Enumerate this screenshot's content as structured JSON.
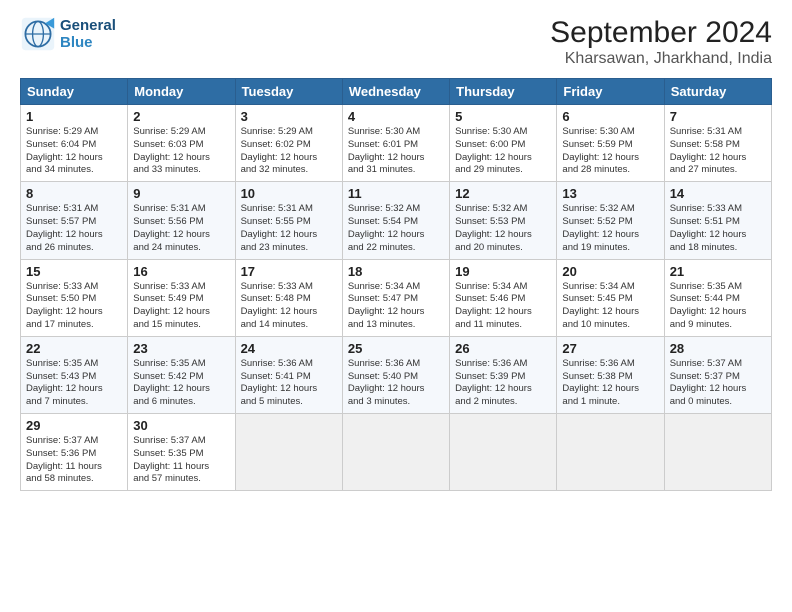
{
  "header": {
    "logo_line1": "General",
    "logo_line2": "Blue",
    "title": "September 2024",
    "subtitle": "Kharsawan, Jharkhand, India"
  },
  "days_of_week": [
    "Sunday",
    "Monday",
    "Tuesday",
    "Wednesday",
    "Thursday",
    "Friday",
    "Saturday"
  ],
  "weeks": [
    [
      {
        "day": "1",
        "detail": "Sunrise: 5:29 AM\nSunset: 6:04 PM\nDaylight: 12 hours\nand 34 minutes."
      },
      {
        "day": "2",
        "detail": "Sunrise: 5:29 AM\nSunset: 6:03 PM\nDaylight: 12 hours\nand 33 minutes."
      },
      {
        "day": "3",
        "detail": "Sunrise: 5:29 AM\nSunset: 6:02 PM\nDaylight: 12 hours\nand 32 minutes."
      },
      {
        "day": "4",
        "detail": "Sunrise: 5:30 AM\nSunset: 6:01 PM\nDaylight: 12 hours\nand 31 minutes."
      },
      {
        "day": "5",
        "detail": "Sunrise: 5:30 AM\nSunset: 6:00 PM\nDaylight: 12 hours\nand 29 minutes."
      },
      {
        "day": "6",
        "detail": "Sunrise: 5:30 AM\nSunset: 5:59 PM\nDaylight: 12 hours\nand 28 minutes."
      },
      {
        "day": "7",
        "detail": "Sunrise: 5:31 AM\nSunset: 5:58 PM\nDaylight: 12 hours\nand 27 minutes."
      }
    ],
    [
      {
        "day": "8",
        "detail": "Sunrise: 5:31 AM\nSunset: 5:57 PM\nDaylight: 12 hours\nand 26 minutes."
      },
      {
        "day": "9",
        "detail": "Sunrise: 5:31 AM\nSunset: 5:56 PM\nDaylight: 12 hours\nand 24 minutes."
      },
      {
        "day": "10",
        "detail": "Sunrise: 5:31 AM\nSunset: 5:55 PM\nDaylight: 12 hours\nand 23 minutes."
      },
      {
        "day": "11",
        "detail": "Sunrise: 5:32 AM\nSunset: 5:54 PM\nDaylight: 12 hours\nand 22 minutes."
      },
      {
        "day": "12",
        "detail": "Sunrise: 5:32 AM\nSunset: 5:53 PM\nDaylight: 12 hours\nand 20 minutes."
      },
      {
        "day": "13",
        "detail": "Sunrise: 5:32 AM\nSunset: 5:52 PM\nDaylight: 12 hours\nand 19 minutes."
      },
      {
        "day": "14",
        "detail": "Sunrise: 5:33 AM\nSunset: 5:51 PM\nDaylight: 12 hours\nand 18 minutes."
      }
    ],
    [
      {
        "day": "15",
        "detail": "Sunrise: 5:33 AM\nSunset: 5:50 PM\nDaylight: 12 hours\nand 17 minutes."
      },
      {
        "day": "16",
        "detail": "Sunrise: 5:33 AM\nSunset: 5:49 PM\nDaylight: 12 hours\nand 15 minutes."
      },
      {
        "day": "17",
        "detail": "Sunrise: 5:33 AM\nSunset: 5:48 PM\nDaylight: 12 hours\nand 14 minutes."
      },
      {
        "day": "18",
        "detail": "Sunrise: 5:34 AM\nSunset: 5:47 PM\nDaylight: 12 hours\nand 13 minutes."
      },
      {
        "day": "19",
        "detail": "Sunrise: 5:34 AM\nSunset: 5:46 PM\nDaylight: 12 hours\nand 11 minutes."
      },
      {
        "day": "20",
        "detail": "Sunrise: 5:34 AM\nSunset: 5:45 PM\nDaylight: 12 hours\nand 10 minutes."
      },
      {
        "day": "21",
        "detail": "Sunrise: 5:35 AM\nSunset: 5:44 PM\nDaylight: 12 hours\nand 9 minutes."
      }
    ],
    [
      {
        "day": "22",
        "detail": "Sunrise: 5:35 AM\nSunset: 5:43 PM\nDaylight: 12 hours\nand 7 minutes."
      },
      {
        "day": "23",
        "detail": "Sunrise: 5:35 AM\nSunset: 5:42 PM\nDaylight: 12 hours\nand 6 minutes."
      },
      {
        "day": "24",
        "detail": "Sunrise: 5:36 AM\nSunset: 5:41 PM\nDaylight: 12 hours\nand 5 minutes."
      },
      {
        "day": "25",
        "detail": "Sunrise: 5:36 AM\nSunset: 5:40 PM\nDaylight: 12 hours\nand 3 minutes."
      },
      {
        "day": "26",
        "detail": "Sunrise: 5:36 AM\nSunset: 5:39 PM\nDaylight: 12 hours\nand 2 minutes."
      },
      {
        "day": "27",
        "detail": "Sunrise: 5:36 AM\nSunset: 5:38 PM\nDaylight: 12 hours\nand 1 minute."
      },
      {
        "day": "28",
        "detail": "Sunrise: 5:37 AM\nSunset: 5:37 PM\nDaylight: 12 hours\nand 0 minutes."
      }
    ],
    [
      {
        "day": "29",
        "detail": "Sunrise: 5:37 AM\nSunset: 5:36 PM\nDaylight: 11 hours\nand 58 minutes."
      },
      {
        "day": "30",
        "detail": "Sunrise: 5:37 AM\nSunset: 5:35 PM\nDaylight: 11 hours\nand 57 minutes."
      },
      {
        "day": "",
        "detail": ""
      },
      {
        "day": "",
        "detail": ""
      },
      {
        "day": "",
        "detail": ""
      },
      {
        "day": "",
        "detail": ""
      },
      {
        "day": "",
        "detail": ""
      }
    ]
  ]
}
